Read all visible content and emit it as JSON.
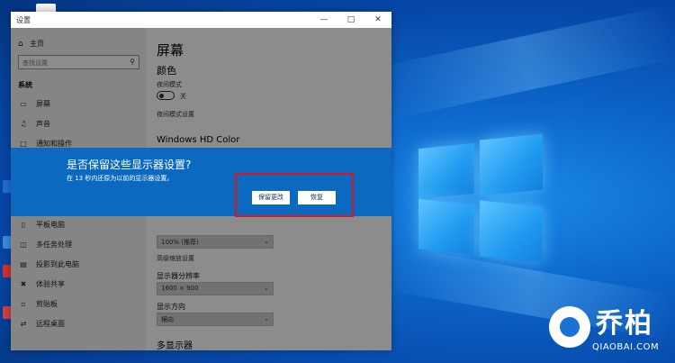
{
  "window": {
    "title": "设置",
    "minimize_icon": "minimize-icon",
    "maximize_icon": "maximize-icon",
    "close_icon": "close-icon"
  },
  "sidebar": {
    "home_label": "主页",
    "search_placeholder": "查找设置",
    "section_title": "系统",
    "items": [
      {
        "label": "屏幕",
        "icon": "monitor-icon"
      },
      {
        "label": "声音",
        "icon": "speaker-icon"
      },
      {
        "label": "通知和操作",
        "icon": "notification-icon"
      },
      {
        "label": "平板电脑",
        "icon": "tablet-icon"
      },
      {
        "label": "多任务处理",
        "icon": "multitask-icon"
      },
      {
        "label": "投影到此电脑",
        "icon": "project-icon"
      },
      {
        "label": "体验共享",
        "icon": "share-icon"
      },
      {
        "label": "剪贴板",
        "icon": "clipboard-icon"
      },
      {
        "label": "远程桌面",
        "icon": "remote-icon"
      }
    ]
  },
  "content": {
    "heading": "屏幕",
    "color_section": "颜色",
    "night_light_label": "夜间模式",
    "night_light_state": "关",
    "night_light_settings": "夜间模式设置",
    "hd_color_title": "Windows HD Color",
    "scale_select_value": "100% (推荐)",
    "advanced_scale_link": "高级缩放设置",
    "resolution_label": "显示器分辨率",
    "resolution_value": "1600 × 900",
    "orientation_label": "显示方向",
    "orientation_value": "横向",
    "multi_display_title": "多显示器"
  },
  "dialog": {
    "title": "是否保留这些显示器设置?",
    "message": "在 13 秒内还原为以前的显示器设置。",
    "keep_button": "保留更改",
    "revert_button": "恢复"
  },
  "watermark": {
    "cn": "乔柏",
    "en": "QIAOBAI.COM"
  },
  "colors": {
    "dialog_bg": "#0b6abf",
    "highlight": "#e0141a",
    "desktop_accent": "#1a8bea"
  }
}
